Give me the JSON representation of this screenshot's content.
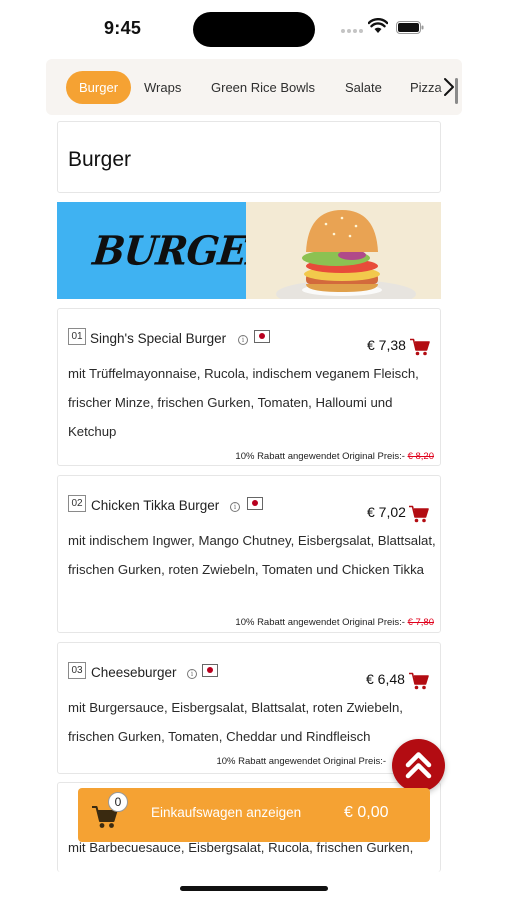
{
  "status_bar": {
    "time": "9:45"
  },
  "categories": {
    "items": [
      {
        "label": "Burger",
        "active": true
      },
      {
        "label": "Wraps",
        "active": false
      },
      {
        "label": "Green Rice Bowls",
        "active": false
      },
      {
        "label": "Salate",
        "active": false
      },
      {
        "label": "Pizza",
        "active": false
      }
    ]
  },
  "section": {
    "title": "Burger",
    "banner_text": "BURGER"
  },
  "products": [
    {
      "number": "01",
      "name": "Singh's Special Burger",
      "price": "€ 7,38",
      "description": "mit Trüffelmayonnaise, Rucola, indischem veganem Fleisch, frischer Minze, frischen Gurken, Tomaten, Halloumi und Ketchup",
      "discount_label": "10% Rabatt angewendet Original Preis:-",
      "original_price": "€ 8,20"
    },
    {
      "number": "02",
      "name": "Chicken Tikka Burger",
      "price": "€ 7,02",
      "description": "mit indischem Ingwer, Mango Chutney, Eisbergsalat, Blattsalat, frischen Gurken, roten Zwiebeln, Tomaten und Chicken Tikka",
      "discount_label": "10% Rabatt angewendet Original Preis:-",
      "original_price": "€ 7,80"
    },
    {
      "number": "03",
      "name": "Cheeseburger",
      "price": "€ 6,48",
      "description": "mit Burgersauce, Eisbergsalat, Blattsalat, roten Zwiebeln, frischen Gurken, Tomaten, Cheddar und Rindfleisch",
      "discount_label": "10% Rabatt angewendet Original Preis:-",
      "original_price": ""
    },
    {
      "description": "mit Barbecuesauce, Eisbergsalat, Rucola, frischen Gurken,"
    }
  ],
  "cart_bar": {
    "count": "0",
    "label": "Einkaufswagen anzeigen",
    "total": "€ 0,00"
  },
  "colors": {
    "accent": "#f5a233",
    "cart_red": "#b30c12",
    "strike_red": "#e0001b",
    "banner_blue": "#3fb2f2"
  }
}
